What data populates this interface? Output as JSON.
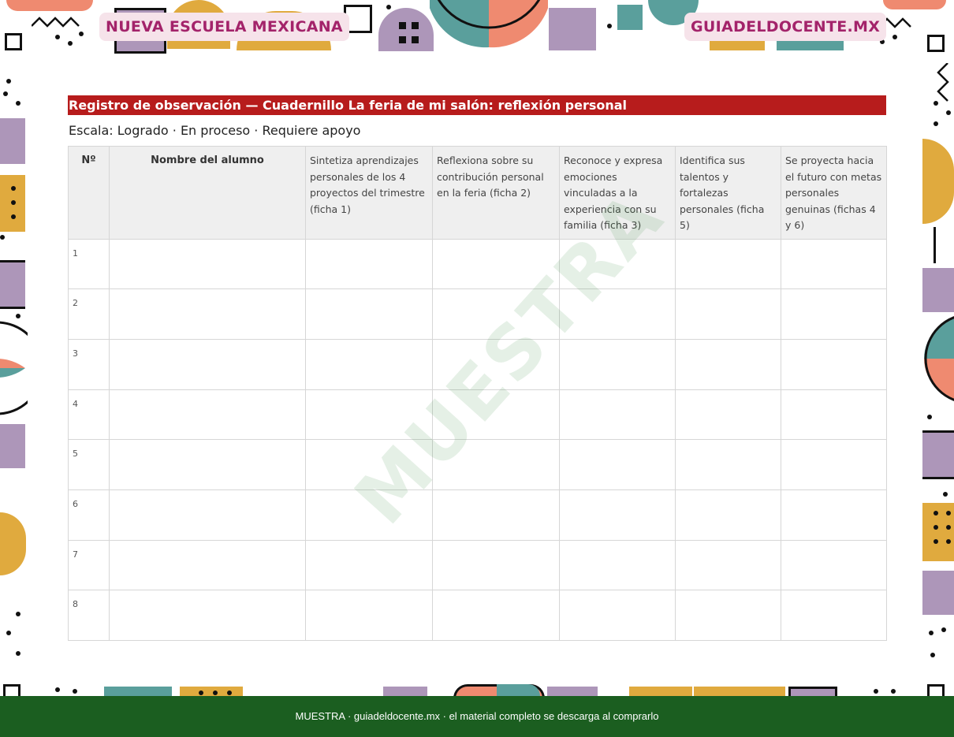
{
  "header": {
    "brand_left": "NUEVA ESCUELA MEXICANA",
    "brand_right": "GUIADELDOCENTE.MX"
  },
  "document": {
    "title": "Registro de observación — Cuadernillo La feria de mi salón: reflexión personal",
    "scale": "Escala: Logrado · En proceso · Requiere apoyo"
  },
  "table": {
    "headers": [
      "Nº",
      "Nombre del alumno",
      "Sintetiza aprendizajes personales de los 4 proyectos del trimestre (ficha 1)",
      "Reflexiona sobre su contribución personal en la feria (ficha 2)",
      "Reconoce y expresa emociones vinculadas a la experiencia con su familia (ficha 3)",
      "Identifica sus talentos y fortalezas personales (ficha 5)",
      "Se proyecta hacia el futuro con metas personales genuinas (fichas 4 y 6)"
    ],
    "row_numbers": [
      "1",
      "2",
      "3",
      "4",
      "5",
      "6",
      "7",
      "8"
    ]
  },
  "watermark": "MUESTRA",
  "footer": {
    "text": "MUESTRA · guiadeldocente.mx · el material completo se descarga al comprarlo"
  },
  "colors": {
    "title_bar": "#b71c1c",
    "footer": "#1b5e20",
    "brand_text": "#a3236a",
    "brand_pill": "#f6e3ea",
    "deco_purple": "#ad96b9",
    "deco_yellow": "#e0aa3e",
    "deco_salmon": "#ef8a70",
    "deco_teal": "#5a9f9c"
  }
}
